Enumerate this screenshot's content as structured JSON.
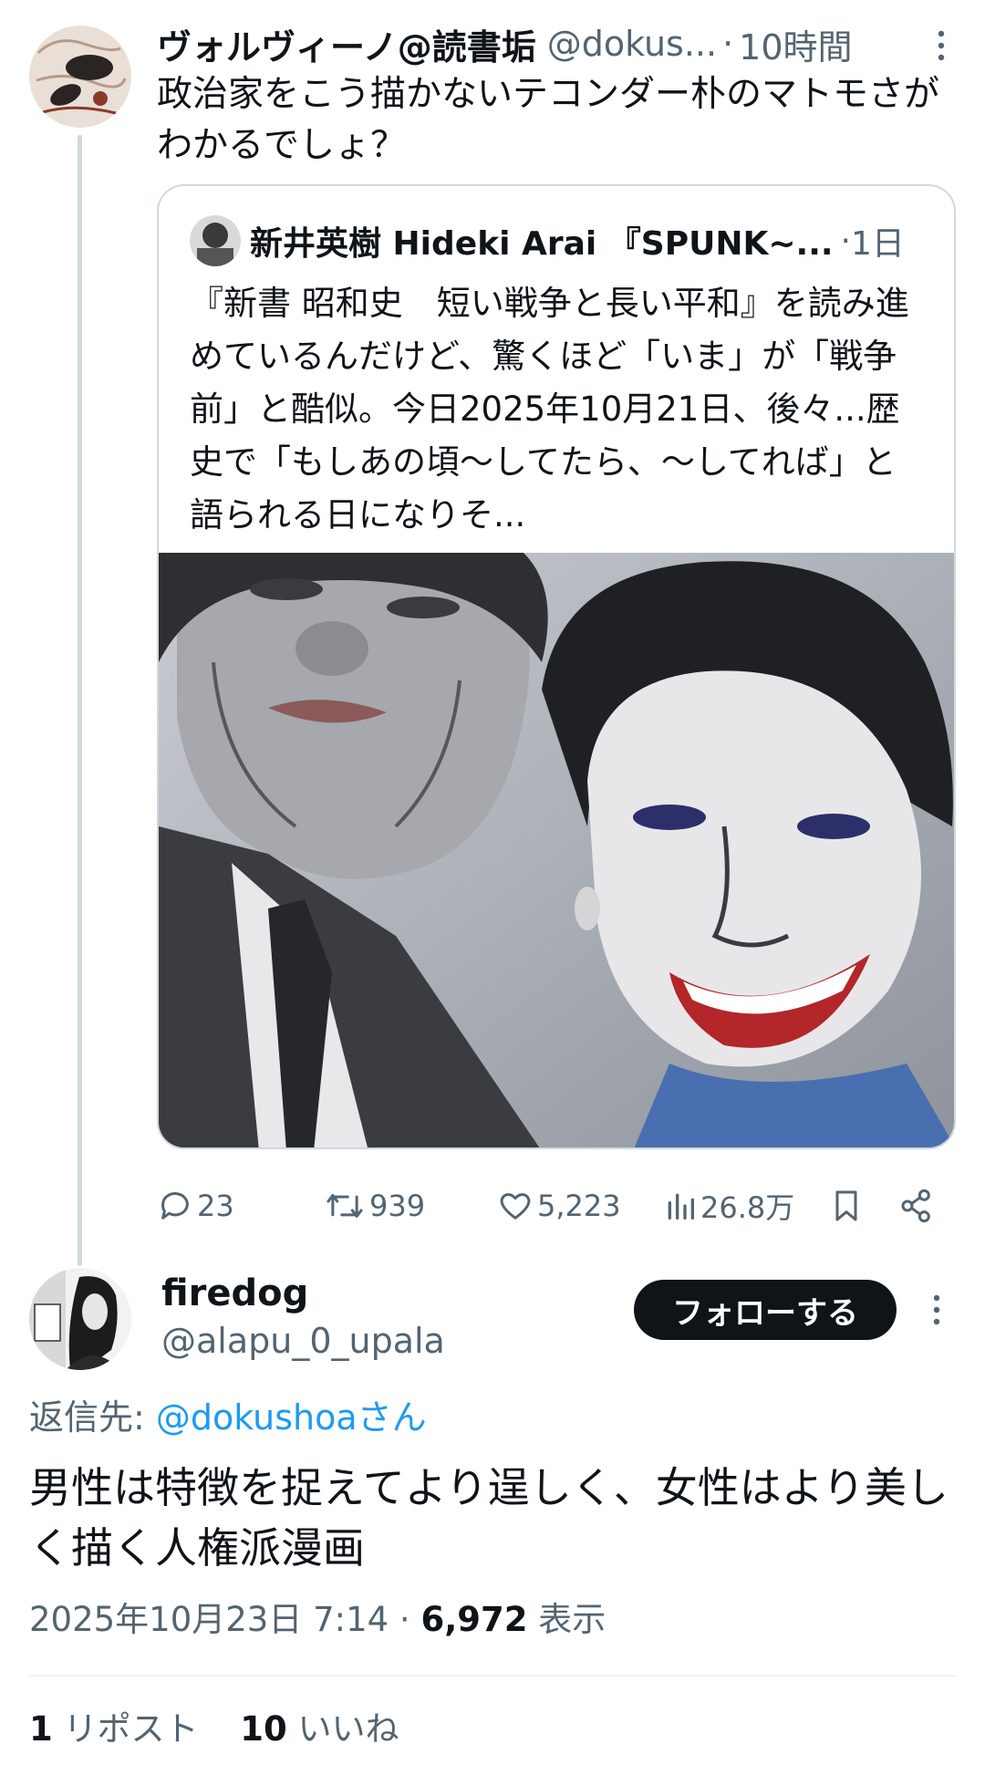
{
  "parent_tweet": {
    "display_name": "ヴォルヴィーノ@読書垢",
    "handle": "@dokus...",
    "time": "10時間",
    "text": "政治家をこう描かないテコンダー朴のマトモさがわかるでしょ？"
  },
  "quoted_tweet": {
    "display_name": "新井英樹 Hideki Arai 『SPUNK~...",
    "time": "1日",
    "text": "『新書 昭和史　短い戦争と長い平和』を読み進めているんだけど、驚くほど「いま」が「戦争前」と酷似。今日2025年10月21日、後々...歴史で「もしあの頃〜してたら、〜してれば」と語られる日になりそ..."
  },
  "actions": {
    "replies": "23",
    "reposts": "939",
    "likes": "5,223",
    "views": "26.8万"
  },
  "reply_tweet": {
    "display_name": "firedog",
    "handle": "@alapu_0_upala",
    "follow_label": "フォローする",
    "reply_to_label": "返信先:",
    "reply_to_mention": "@dokushoaさん",
    "text": "男性は特徴を捉えてより逞しく、女性はより美しく描く人権派漫画",
    "timestamp": "2025年10月23日 7:14 · ",
    "view_count": "6,972",
    "view_label": " 表示",
    "repost_count": "1",
    "repost_label": " リポスト",
    "like_count": "10",
    "like_label": " いいね"
  },
  "colors": {
    "text": "#0f1419",
    "secondary": "#536471",
    "accent": "#1d9bf0",
    "border": "#cfd9de"
  },
  "icons": [
    "more-vertical-icon",
    "reply-icon",
    "repost-icon",
    "like-icon",
    "views-icon",
    "bookmark-icon",
    "share-icon"
  ]
}
